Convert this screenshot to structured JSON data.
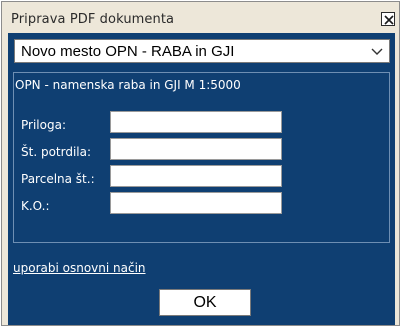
{
  "window": {
    "title": "Priprava PDF dokumenta",
    "close_icon": "close-x-icon"
  },
  "select": {
    "value": "Novo mesto OPN - RABA in GJI",
    "icon": "chevron-down-icon"
  },
  "group": {
    "title": "OPN - namenska raba in GJI M 1:5000",
    "fields": [
      {
        "label": "Priloga:",
        "value": ""
      },
      {
        "label": "Št. potrdila:",
        "value": ""
      },
      {
        "label": "Parcelna št.:",
        "value": ""
      },
      {
        "label": "K.O.:",
        "value": ""
      }
    ]
  },
  "link": {
    "label": "uporabi osnovni način"
  },
  "buttons": {
    "ok_label": "OK"
  },
  "colors": {
    "dialog_bg": "#ede7d9",
    "panel_bg": "#0f3f72",
    "group_border": "#6e8fb3",
    "text_light": "#ffffff"
  }
}
